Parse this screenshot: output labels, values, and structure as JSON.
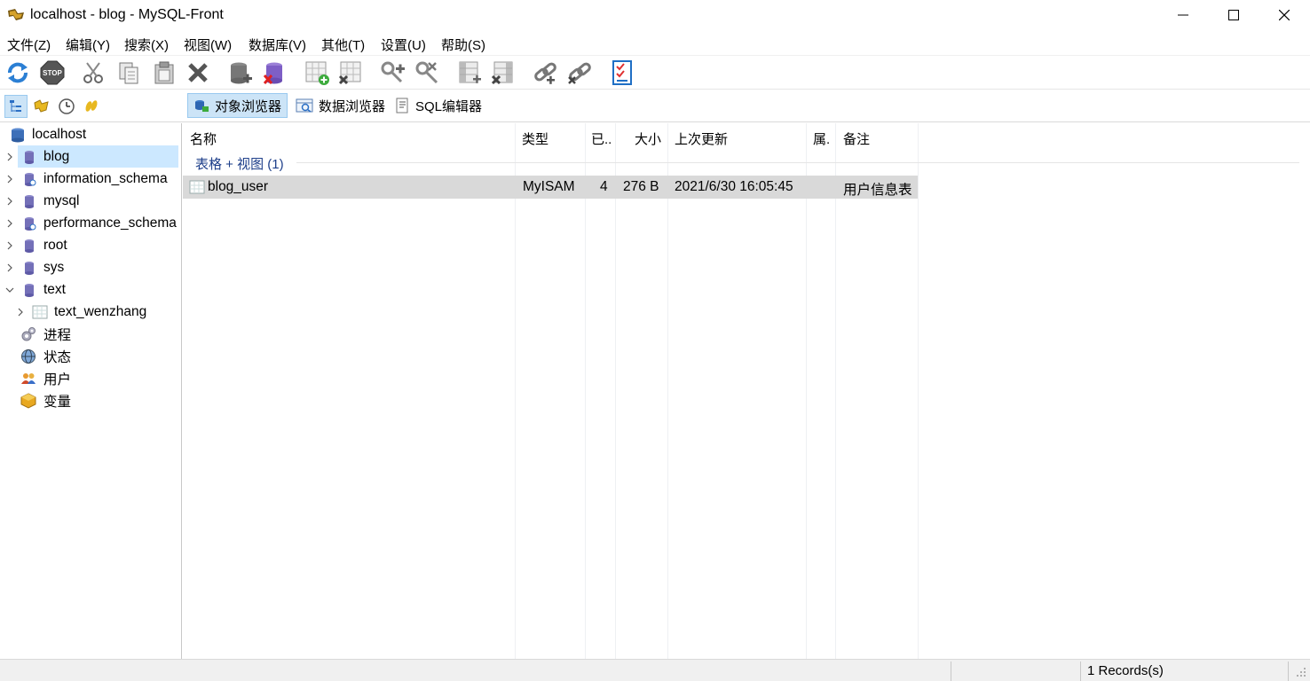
{
  "window": {
    "title": "localhost - blog - MySQL-Front",
    "minimize_icon": "minimize-icon",
    "maximize_icon": "maximize-icon",
    "close_icon": "close-icon"
  },
  "menu": {
    "items": [
      {
        "label": "文件(Z)"
      },
      {
        "label": "编辑(Y)"
      },
      {
        "label": "搜索(X)"
      },
      {
        "label": "视图(W)"
      },
      {
        "label": "数据库(V)"
      },
      {
        "label": "其他(T)"
      },
      {
        "label": "设置(U)"
      },
      {
        "label": "帮助(S)"
      }
    ]
  },
  "toolbar": {
    "icons": [
      "refresh-icon",
      "stop-icon",
      "cut-icon",
      "copy-icon",
      "paste-icon",
      "delete-icon",
      "add-database-icon",
      "drop-database-icon",
      "add-table-icon",
      "drop-table-icon",
      "add-field-icon",
      "drop-field-icon",
      "add-index-icon",
      "drop-index-icon",
      "add-link-icon",
      "drop-link-icon",
      "properties-icon"
    ]
  },
  "viewbar": {
    "side_icons": [
      "tree-view-icon",
      "favorites-icon",
      "history-icon",
      "bookmark-icon"
    ],
    "object_browser": "对象浏览器",
    "data_browser": "数据浏览器",
    "sql_editor": "SQL编辑器"
  },
  "sidebar": {
    "server": "localhost",
    "databases": [
      {
        "label": "blog",
        "selected": true,
        "expanded": false
      },
      {
        "label": "information_schema",
        "selected": false,
        "expanded": false
      },
      {
        "label": "mysql",
        "selected": false,
        "expanded": false
      },
      {
        "label": "performance_schema",
        "selected": false,
        "expanded": false
      },
      {
        "label": "root",
        "selected": false,
        "expanded": false
      },
      {
        "label": "sys",
        "selected": false,
        "expanded": false
      },
      {
        "label": "text",
        "selected": false,
        "expanded": true
      }
    ],
    "text_tables": [
      {
        "label": "text_wenzhang"
      }
    ],
    "extras": [
      {
        "label": "进程",
        "icon": "process-icon"
      },
      {
        "label": "状态",
        "icon": "status-globe-icon"
      },
      {
        "label": "用户",
        "icon": "users-icon"
      },
      {
        "label": "变量",
        "icon": "variables-icon"
      }
    ]
  },
  "table": {
    "columns": [
      "名称",
      "类型",
      "已...",
      "大小",
      "上次更新",
      "属.",
      "备注"
    ],
    "group_label": "表格 + 视图 (1)",
    "rows": [
      {
        "name": "blog_user",
        "type": "MyISAM",
        "records": "4",
        "size": "276 B",
        "updated": "2021/6/30 16:05:45",
        "attr": "",
        "comment": "用户信息表"
      }
    ]
  },
  "status": {
    "records": "1 Records(s)"
  },
  "colors": {
    "selection": "#cce8ff",
    "active_button": "#cce4f7",
    "row_highlight": "#d9d9d9",
    "group_text": "#1e3f8a"
  }
}
